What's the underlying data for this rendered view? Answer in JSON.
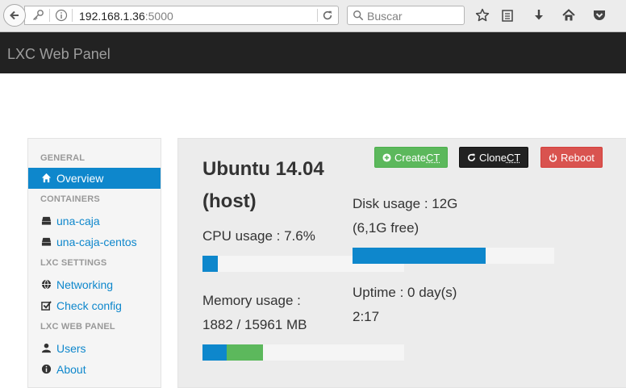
{
  "browser": {
    "url_host": "192.168.1.36",
    "url_port": ":5000",
    "search_placeholder": "Buscar"
  },
  "app": {
    "brand": "LXC Web Panel"
  },
  "sidebar": {
    "sections": {
      "general": "GENERAL",
      "containers": "CONTAINERS",
      "lxc_settings": "LXC SETTINGS",
      "lxc_web_panel": "LXC WEB PANEL"
    },
    "items": {
      "overview": "Overview",
      "una_caja": "una-caja",
      "una_caja_centos": "una-caja-centos",
      "networking": "Networking",
      "check_config": "Check config",
      "users": "Users",
      "about": "About"
    }
  },
  "actions": {
    "create": {
      "prefix": "Create ",
      "abbr": "CT"
    },
    "clone": {
      "prefix": "Clone ",
      "abbr": "CT"
    },
    "reboot": "Reboot"
  },
  "host": {
    "title": "Ubuntu 14.04 (host)",
    "cpu_label": "CPU usage : 7.6%",
    "cpu_percent": 7.6,
    "memory_label_1": "Memory usage :",
    "memory_label_2": "1882 / 15961 MB",
    "memory_used_fraction": 0.118,
    "memory_second_segment_fraction": 0.18,
    "disk_label_1": "Disk usage : 12G",
    "disk_label_2": "(6,1G free)",
    "disk_used_fraction": 0.66,
    "uptime_label_1": "Uptime : 0 day(s)",
    "uptime_label_2": "2:17"
  },
  "colors": {
    "primary": "#0e87cc",
    "success": "#5cb85c",
    "danger": "#d9534f",
    "navbar": "#222222"
  }
}
